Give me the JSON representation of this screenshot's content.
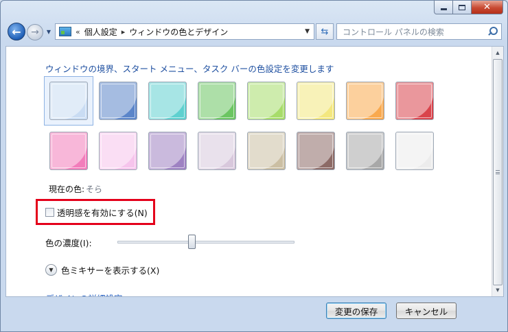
{
  "window": {
    "caption": {
      "close_glyph": "✕"
    }
  },
  "navbar": {
    "breadcrumb_overflow": "«",
    "breadcrumb": [
      "個人設定",
      "ウィンドウの色とデザイン"
    ],
    "search_placeholder": "コントロール パネルの検索"
  },
  "content": {
    "heading": "ウィンドウの境界、スタート メニュー、タスク バーの色設定を変更します",
    "swatches": [
      [
        {
          "color": "#c9dcf3",
          "selected": true
        },
        {
          "color": "#5b85c9",
          "selected": false
        },
        {
          "color": "#5fd0cf",
          "selected": false
        },
        {
          "color": "#6bc561",
          "selected": false
        },
        {
          "color": "#a7dc6a",
          "selected": false
        },
        {
          "color": "#f3e77f",
          "selected": false
        },
        {
          "color": "#f9a94e",
          "selected": false
        },
        {
          "color": "#d9434b",
          "selected": false
        }
      ],
      [
        {
          "color": "#f27dbb",
          "selected": false
        },
        {
          "color": "#f6c4ec",
          "selected": false
        },
        {
          "color": "#9e82c2",
          "selected": false
        },
        {
          "color": "#d8c8dc",
          "selected": false
        },
        {
          "color": "#cbbfa3",
          "selected": false
        },
        {
          "color": "#8c6a66",
          "selected": false
        },
        {
          "color": "#a8a8a8",
          "selected": false
        },
        {
          "color": "#ececec",
          "selected": false
        }
      ]
    ],
    "current_color_label": "現在の色:",
    "current_color_value": "そら",
    "transparency": {
      "label": "透明感を有効にする(N)",
      "checked": false,
      "highlight_color": "#e4001a"
    },
    "intensity": {
      "label": "色の濃度(I):",
      "value_fraction": 0.42
    },
    "mixer_label": "色ミキサーを表示する(X)",
    "advanced_link": "デザインの詳細設定..."
  },
  "footer": {
    "save_label": "変更の保存",
    "cancel_label": "キャンセル"
  }
}
